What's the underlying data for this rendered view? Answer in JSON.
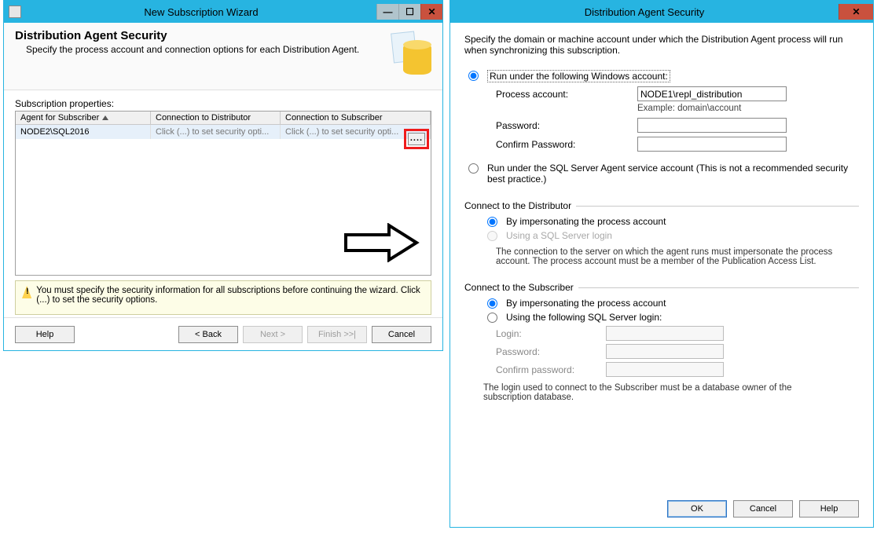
{
  "wizard": {
    "title": "New Subscription Wizard",
    "header_title": "Distribution Agent Security",
    "header_sub": "Specify the process account and connection options for each Distribution Agent.",
    "props_label": "Subscription properties:",
    "columns": {
      "c1": "Agent for Subscriber",
      "c2": "Connection to Distributor",
      "c3": "Connection to Subscriber"
    },
    "row": {
      "agent": "NODE2\\SQL2016",
      "dist": "Click (...) to set security opti...",
      "sub": "Click (...) to set security opti..."
    },
    "ellipsis": "....",
    "warning": "You must specify the security information for all subscriptions before continuing the wizard. Click (...) to set the security options.",
    "buttons": {
      "help": "Help",
      "back": "< Back",
      "next": "Next >",
      "finish": "Finish >>|",
      "cancel": "Cancel"
    }
  },
  "dialog": {
    "title": "Distribution Agent Security",
    "desc": "Specify the domain or machine account under which the Distribution Agent process will run when synchronizing this subscription.",
    "opt1": "Run under the following Windows account:",
    "process_account_label": "Process account:",
    "process_account_value": "NODE1\\repl_distribution",
    "example": "Example: domain\\account",
    "password_label": "Password:",
    "confirm_password_label": "Confirm Password:",
    "opt2": "Run under the SQL Server Agent service account (This is not a recommended security best practice.)",
    "group_distributor": "Connect to the Distributor",
    "dist_opt1": "By impersonating the process account",
    "dist_opt2": "Using a SQL Server login",
    "dist_note": "The connection to the server on which the agent runs must impersonate the process account. The process account must be a member of the Publication Access List.",
    "group_subscriber": "Connect to the Subscriber",
    "sub_opt1": "By impersonating the process account",
    "sub_opt2": "Using the following SQL Server login:",
    "sub_login": "Login:",
    "sub_password": "Password:",
    "sub_confirm": "Confirm password:",
    "sub_note": "The login used to connect to the Subscriber must be a database owner of the subscription database.",
    "buttons": {
      "ok": "OK",
      "cancel": "Cancel",
      "help": "Help"
    }
  }
}
